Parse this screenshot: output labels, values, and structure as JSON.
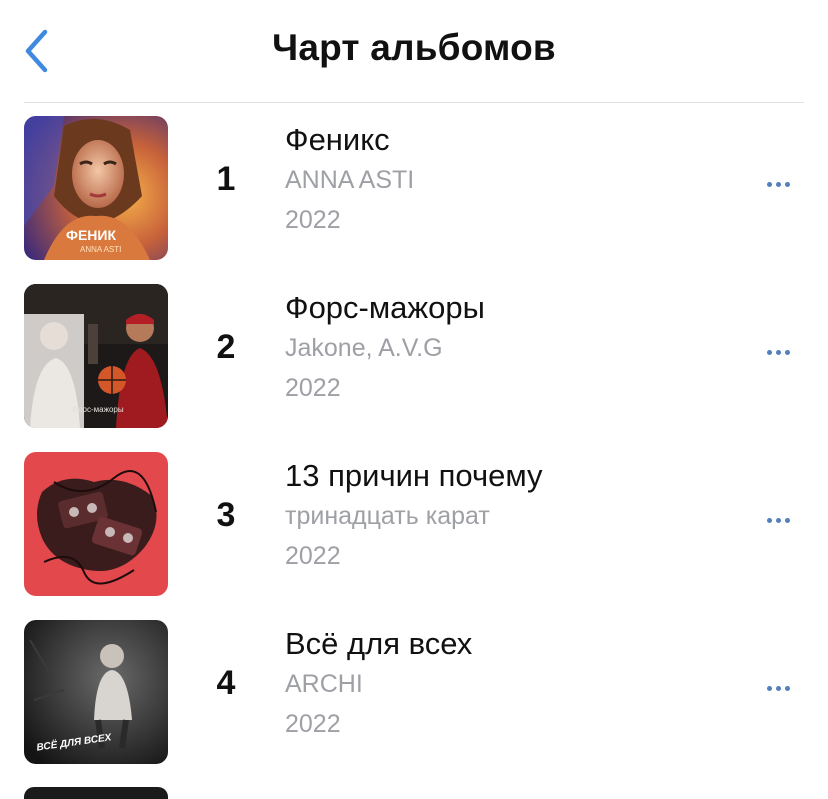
{
  "header": {
    "title": "Чарт альбомов",
    "back_icon": "chevron-left-icon",
    "accent_color": "#3f8ae0"
  },
  "albums": [
    {
      "rank": "1",
      "name": "Феникс",
      "artist": "ANNA ASTI",
      "year": "2022",
      "cover_text": "ФЕНИК",
      "cover_subtext": "ANNA ASTI"
    },
    {
      "rank": "2",
      "name": "Форс-мажоры",
      "artist": "Jakone, A.V.G",
      "year": "2022",
      "cover_text": "Форс-мажоры"
    },
    {
      "rank": "3",
      "name": "13 причин почему",
      "artist": "тринадцать карат",
      "year": "2022"
    },
    {
      "rank": "4",
      "name": "Всё для всех",
      "artist": "ARCHI",
      "year": "2022",
      "cover_text": "ВСЁ ДЛЯ ВСЕХ"
    }
  ],
  "row_menu_icon": "more-horizontal-icon",
  "colors": {
    "menu_dots": "#5181b8",
    "secondary_text": "#9ea0a5"
  }
}
